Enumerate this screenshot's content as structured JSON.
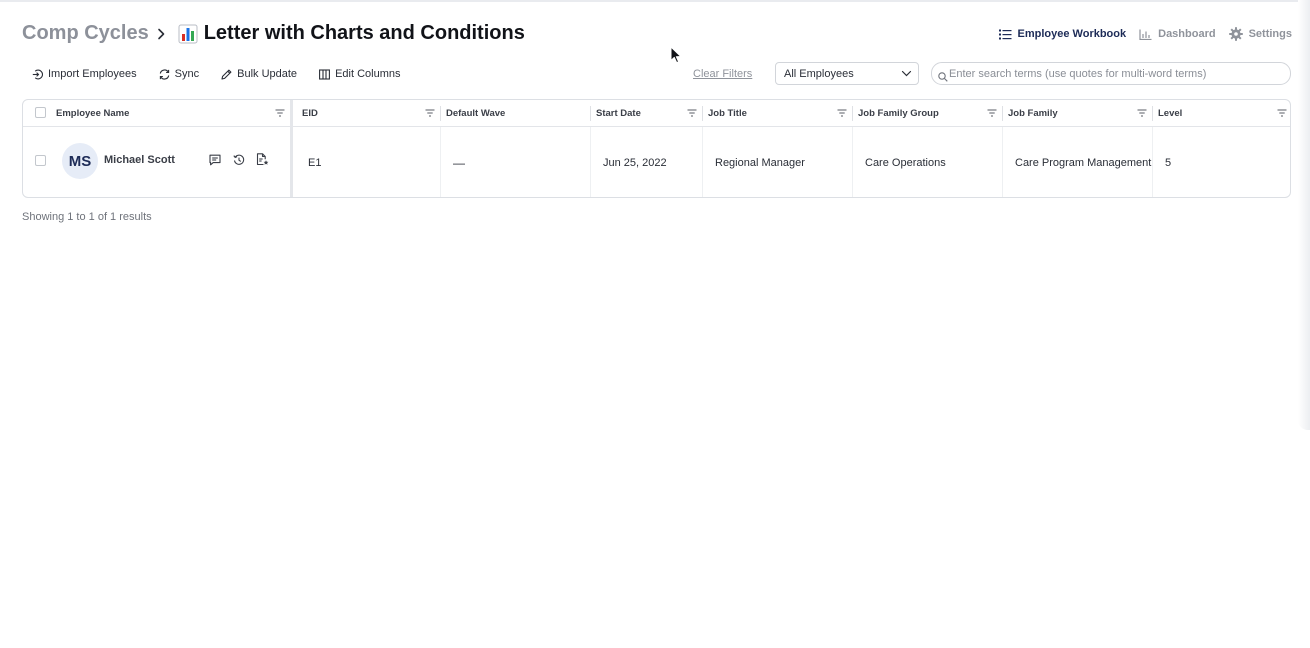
{
  "breadcrumb": {
    "root": "Comp Cycles",
    "title": "Letter with Charts and Conditions"
  },
  "topnav": {
    "items": [
      {
        "label": "Employee Workbook",
        "icon": "list-icon",
        "active": true
      },
      {
        "label": "Dashboard",
        "icon": "bar-chart-icon",
        "active": false
      },
      {
        "label": "Settings",
        "icon": "gear-icon",
        "active": false
      }
    ]
  },
  "toolbar": {
    "import_label": "Import Employees",
    "sync_label": "Sync",
    "bulk_update_label": "Bulk Update",
    "edit_columns_label": "Edit Columns"
  },
  "filters": {
    "clear_label": "Clear Filters",
    "employee_filter_value": "All Employees",
    "search_placeholder": "Enter search terms (use quotes for multi-word terms)"
  },
  "table": {
    "columns": [
      "Employee Name",
      "EID",
      "Default Wave",
      "Start Date",
      "Job Title",
      "Job Family Group",
      "Job Family",
      "Level"
    ],
    "rows": [
      {
        "initials": "MS",
        "name": "Michael Scott",
        "eid": "E1",
        "default_wave": "—",
        "start_date": "Jun 25, 2022",
        "job_title": "Regional Manager",
        "job_family_group": "Care Operations",
        "job_family": "Care Program Management",
        "level": "5"
      }
    ]
  },
  "footer": {
    "results_text": "Showing 1 to 1 of 1 results"
  },
  "colors": {
    "accent_navy": "#1d2b57",
    "muted_gray": "#8f939b",
    "avatar_bg": "#e6ecf7"
  }
}
